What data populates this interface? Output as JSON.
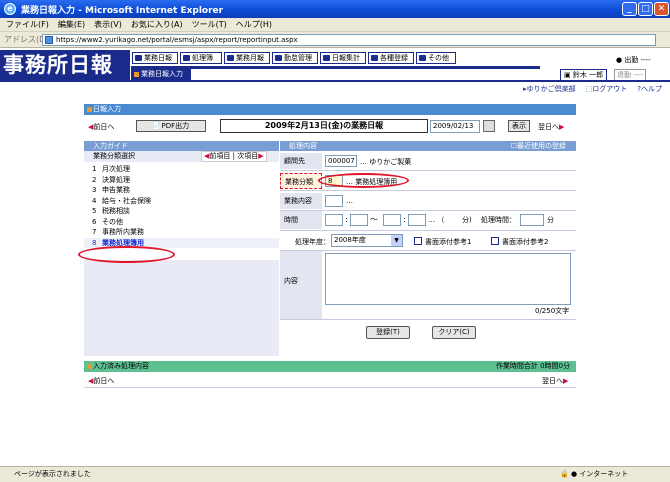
{
  "window": {
    "title": "業務日報入力 - Microsoft Internet Explorer"
  },
  "menu": [
    "ファイル(F)",
    "編集(E)",
    "表示(V)",
    "お気に入り(A)",
    "ツール(T)",
    "ヘルプ(H)"
  ],
  "address": {
    "label": "アドレス(D)",
    "url": "https://www2.yurikago.net/portal/esmsj/aspx/report/reportinput.aspx"
  },
  "header": {
    "logo": "事務所日報",
    "breadcrumb": "業務日報入力",
    "nav": [
      "業務日報",
      "処理簿",
      "業務月報",
      "勤怠管理",
      "日報集計",
      "各種登録",
      "その他"
    ],
    "logout": "出勤 ----",
    "user": "鈴木 一郎",
    "user_status": "退勤 ----"
  },
  "links": {
    "company": "ゆりかご倶楽部",
    "logout": "ログアウト",
    "help": "ヘルプ"
  },
  "report": {
    "section": "日報入力",
    "prev": "前日へ",
    "pdf": "PDF出力",
    "title": "2009年2月13日(金)の業務日報",
    "date_value": "2009/02/13",
    "show": "表示",
    "next": "翌日へ"
  },
  "guide": {
    "title": "入力ガイド",
    "subtitle": "業務分類選択",
    "prev_item": "前項目",
    "next_item": "次項目",
    "items": [
      {
        "no": "1",
        "label": "月次処理"
      },
      {
        "no": "2",
        "label": "決算処理"
      },
      {
        "no": "3",
        "label": "申告業務"
      },
      {
        "no": "4",
        "label": "給与・社会保険"
      },
      {
        "no": "5",
        "label": "税務相談"
      },
      {
        "no": "6",
        "label": "その他"
      },
      {
        "no": "7",
        "label": "事務所内業務"
      },
      {
        "no": "8",
        "label": "業務処理簿用"
      }
    ]
  },
  "process": {
    "title": "処理内容",
    "recent": "最近使用の登録",
    "client_label": "顧問先",
    "client_code": "000007",
    "client_name": "ゆりかご製菓",
    "category_label": "業務分類",
    "category_code": "8",
    "category_name": "業務処理簿用",
    "content_label": "業務内容",
    "time_label": "時間",
    "time_sep1": "～",
    "paren_open": "（",
    "minutes": "分)",
    "proc_time_label": "処理時間：",
    "min": "分",
    "year_label": "処理年度：",
    "year_value": "2008年度",
    "attach1": "書面添付参考1",
    "attach2": "書面添付参考2",
    "memo_label": "内容",
    "counter": "0/250文字",
    "register": "登録(T)",
    "clear": "クリア(C)"
  },
  "done": {
    "title": "入力済み処理内容",
    "total": "作業時間合計 0時間0分",
    "prev": "前日へ",
    "next": "翌日へ"
  },
  "status": {
    "text": "ページが表示されました",
    "zone": "インターネット"
  }
}
